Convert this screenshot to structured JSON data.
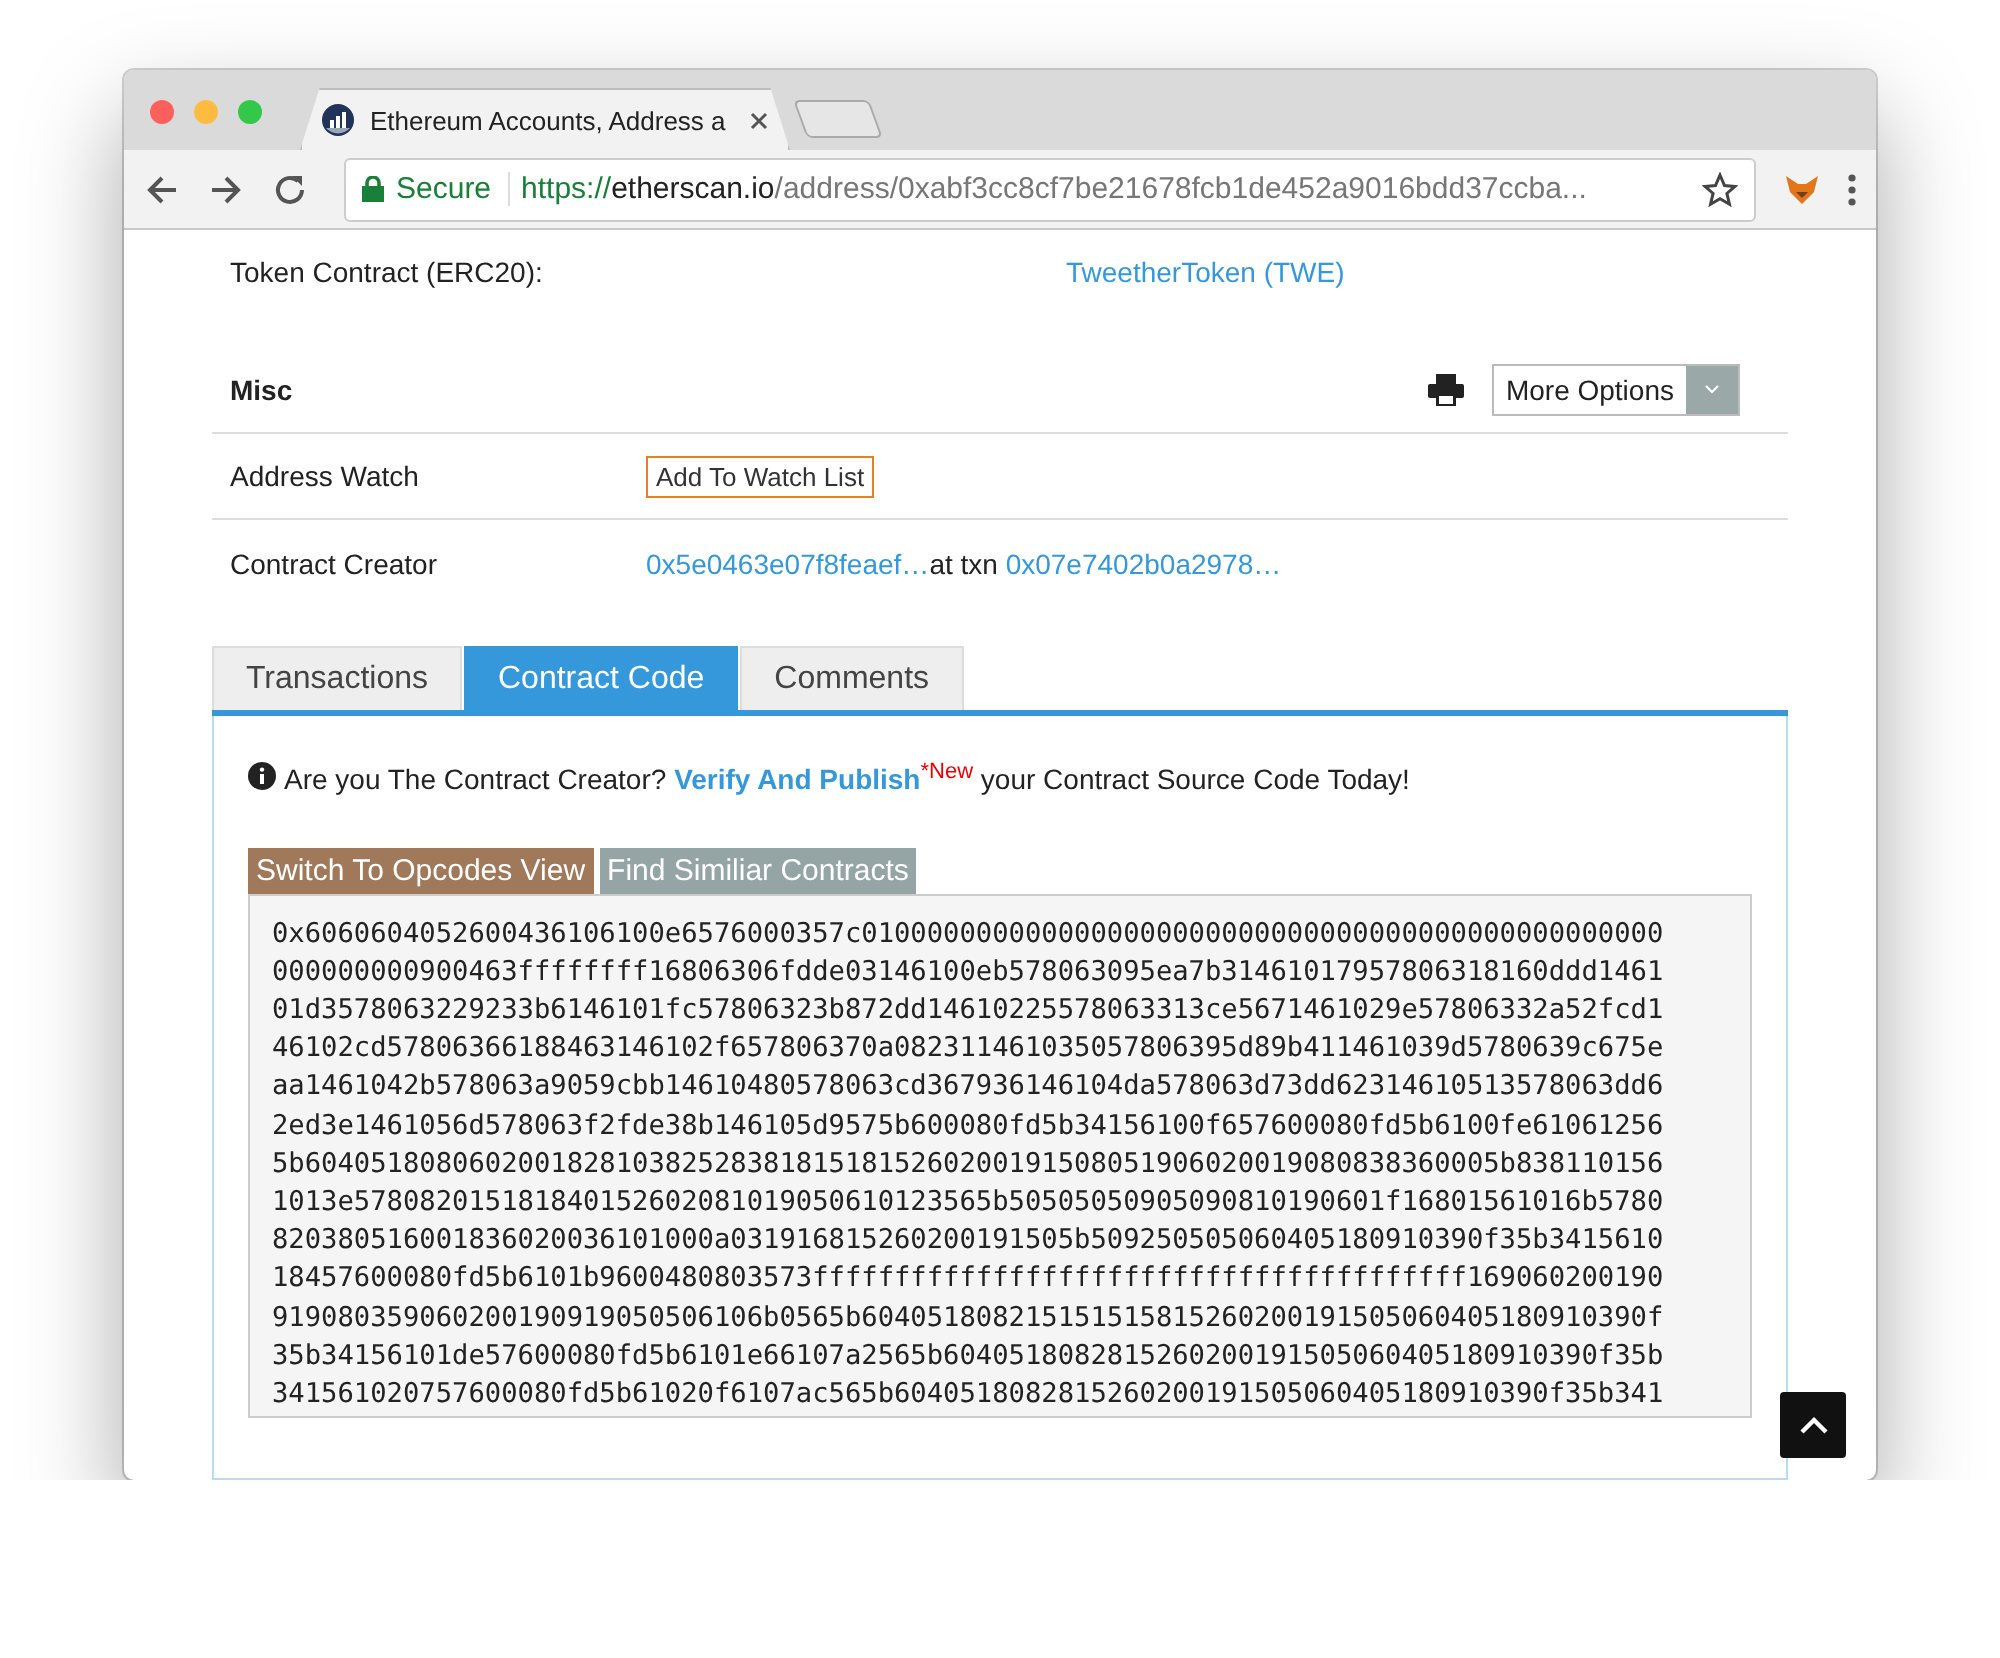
{
  "window": {
    "tab_title": "Ethereum Accounts, Address a",
    "secure": "Secure",
    "url_scheme": "https://",
    "url_host": "etherscan.io",
    "url_path": "/address/0xabf3cc8cf7be21678fcb1de452a9016bdd37ccba..."
  },
  "token_contract": {
    "label": "Token Contract (ERC20):",
    "value": "TweetherToken (TWE)"
  },
  "misc": {
    "title": "Misc",
    "more_options": "More Options"
  },
  "rows": [
    {
      "label": "Address Watch",
      "kind": "button",
      "button": "Add To Watch List"
    },
    {
      "label": "Contract Creator",
      "kind": "links",
      "creator": "0x5e0463e07f8feaef…",
      "between": "at txn",
      "txn": "0x07e7402b0a2978…"
    }
  ],
  "tabs": [
    {
      "label": "Transactions",
      "selected": false
    },
    {
      "label": "Contract Code",
      "selected": true
    },
    {
      "label": "Comments",
      "selected": false
    }
  ],
  "notice": {
    "text": "Are you The Contract Creator?",
    "link": "Verify And Publish",
    "badge": "*New",
    "tail": "your Contract Source Code Today!"
  },
  "code_buttons": [
    {
      "label": "Switch To Opcodes View",
      "kind": "primary"
    },
    {
      "label": "Find Similiar Contracts",
      "kind": "secondary"
    }
  ],
  "bytecode_lines": [
    "0x6060604052600436106100e6576000357c0100000000000000000000000000000000000000000000000",
    "000000000900463ffffffff16806306fdde03146100eb578063095ea7b31461017957806318160ddd1461",
    "01d3578063229233b6146101fc57806323b872dd14610225578063313ce5671461029e57806332a52fcd1",
    "46102cd57806366188463146102f657806370a082311461035057806395d89b411461039d5780639c675e",
    "aa1461042b578063a9059cbb14610480578063cd367936146104da578063d73dd62314610513578063dd6",
    "2ed3e1461056d578063f2fde38b146105d9575b600080fd5b34156100f657600080fd5b6100fe61061256",
    "5b6040518080602001828103825283818151815260200191508051906020019080838360005b838110156",
    "1013e578082015181840152602081019050610123565b50505050905090810190601f16801561016b5780",
    "820380516001836020036101000a031916815260200191505b509250505060405180910390f35b3415610",
    "18457600080fd5b6101b9600480803573ffffffffffffffffffffffffffffffffffffffff169060200190",
    "919080359060200190919050506106b0565b604051808215151515815260200191505060405180910390f",
    "35b34156101de57600080fd5b6101e66107a2565b6040518082815260200191505060405180910390f35b",
    "341561020757600080fd5b61020f6107ac565b6040518082815260200191505060405180910390f35b341"
  ]
}
